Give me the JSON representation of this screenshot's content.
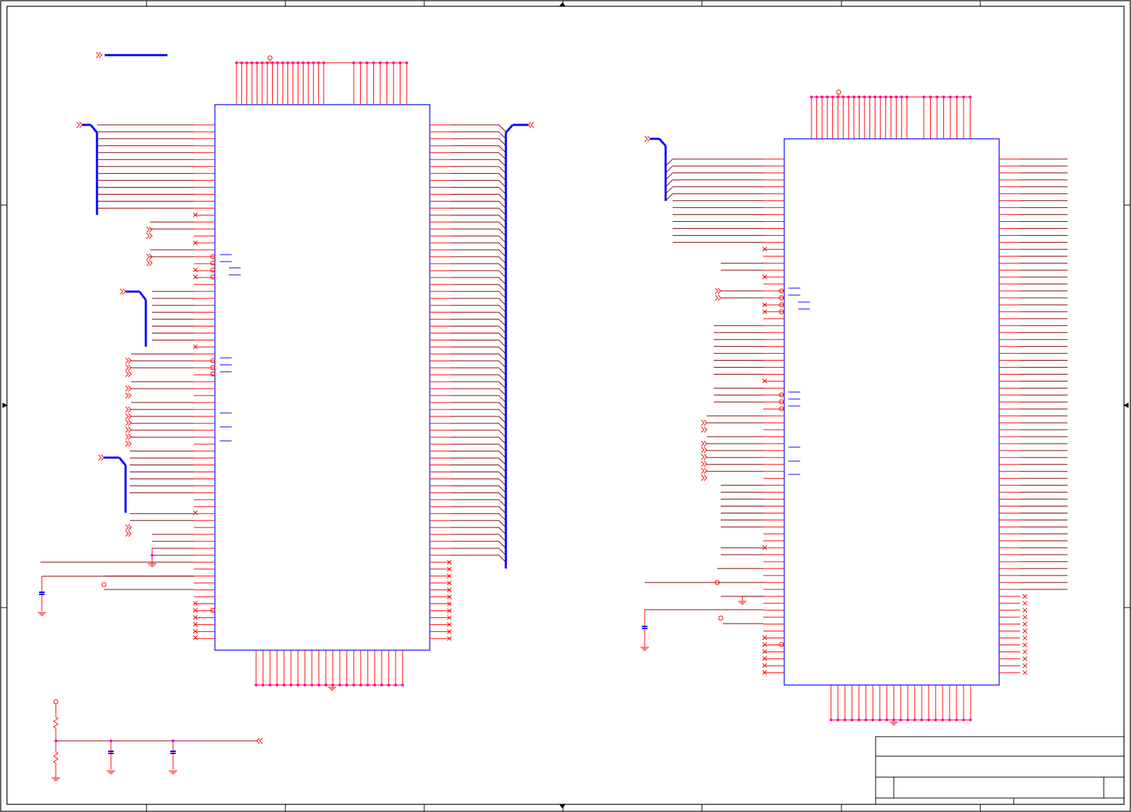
{
  "sheet": {
    "title_block": {
      "title": "",
      "document_number": "",
      "revision": "",
      "size": "",
      "date": "",
      "sheet_of": ""
    }
  },
  "colors": {
    "border": "#000000",
    "ic_body": "#0000ff",
    "pin": "#ff0000",
    "net_wire": "#800000",
    "bus": "#0000ff",
    "junction": "#ff00ff",
    "passive": "#ff0000",
    "capacitor_plate": "#0000ff"
  },
  "components": [
    {
      "id": "u1",
      "kind": "ic-qfp",
      "left_pins": 76,
      "right_pins": 76,
      "top_pins": 25,
      "bottom_pins": 21
    },
    {
      "id": "u2",
      "kind": "ic-qfp",
      "left_pins": 76,
      "right_pins": 76,
      "top_pins": 25,
      "bottom_pins": 21
    },
    {
      "id": "r1",
      "kind": "resistor"
    },
    {
      "id": "r2",
      "kind": "resistor"
    },
    {
      "id": "c1",
      "kind": "capacitor"
    },
    {
      "id": "c2",
      "kind": "capacitor"
    },
    {
      "id": "c3",
      "kind": "capacitor"
    },
    {
      "id": "c4",
      "kind": "capacitor"
    }
  ]
}
